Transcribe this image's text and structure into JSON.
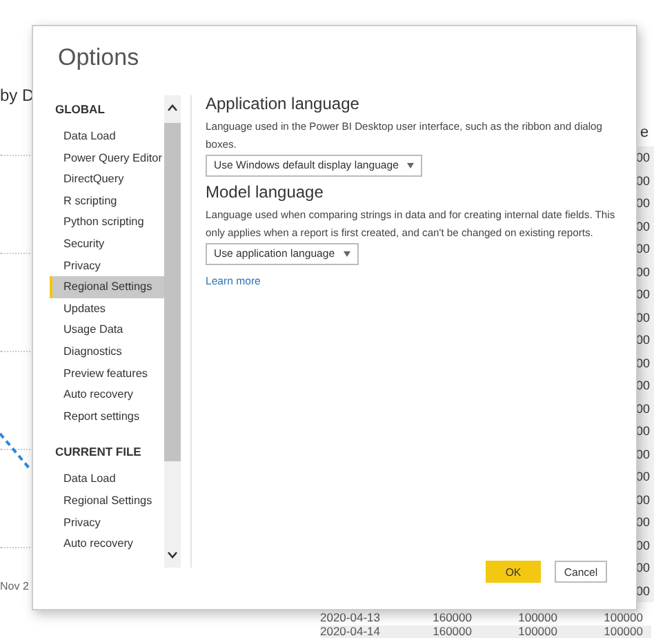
{
  "background": {
    "chart_title": "by D",
    "axis_label": "Nov 2",
    "column_header": "e",
    "column_cells": [
      "00",
      "00",
      "00",
      "00",
      "00",
      "00",
      "00",
      "00",
      "00",
      "00",
      "00",
      "00",
      "00",
      "00",
      "00",
      "00",
      "00",
      "00",
      "00",
      "00"
    ],
    "table_rows": [
      {
        "date": "2020-04-13",
        "col_2": "160000",
        "col_3": "100000",
        "col_4": "100000"
      },
      {
        "date": "2020-04-14",
        "col_2": "160000",
        "col_3": "100000",
        "col_4": "100000"
      }
    ]
  },
  "dialog": {
    "title": "Options",
    "sections": [
      {
        "heading": "GLOBAL",
        "items": [
          {
            "label": "Data Load",
            "selected": false
          },
          {
            "label": "Power Query Editor",
            "selected": false
          },
          {
            "label": "DirectQuery",
            "selected": false
          },
          {
            "label": "R scripting",
            "selected": false
          },
          {
            "label": "Python scripting",
            "selected": false
          },
          {
            "label": "Security",
            "selected": false
          },
          {
            "label": "Privacy",
            "selected": false
          },
          {
            "label": "Regional Settings",
            "selected": true
          },
          {
            "label": "Updates",
            "selected": false
          },
          {
            "label": "Usage Data",
            "selected": false
          },
          {
            "label": "Diagnostics",
            "selected": false
          },
          {
            "label": "Preview features",
            "selected": false
          },
          {
            "label": "Auto recovery",
            "selected": false
          },
          {
            "label": "Report settings",
            "selected": false
          }
        ]
      },
      {
        "heading": "CURRENT FILE",
        "items": [
          {
            "label": "Data Load",
            "selected": false
          },
          {
            "label": "Regional Settings",
            "selected": false
          },
          {
            "label": "Privacy",
            "selected": false
          },
          {
            "label": "Auto recovery",
            "selected": false
          }
        ]
      }
    ],
    "settings": [
      {
        "heading": "Application language",
        "description": "Language used in the Power BI Desktop user interface, such as the ribbon and dialog boxes.",
        "dropdown": "Use Windows default display language"
      },
      {
        "heading": "Model language",
        "description": "Language used when comparing strings in data and for creating internal date fields. This only applies when a report is first created, and can't be changed on existing reports.",
        "dropdown": "Use application language"
      }
    ],
    "link": "Learn more",
    "buttons": [
      {
        "label": "OK",
        "kind": "primary"
      },
      {
        "label": "Cancel",
        "kind": "secondary"
      }
    ]
  }
}
